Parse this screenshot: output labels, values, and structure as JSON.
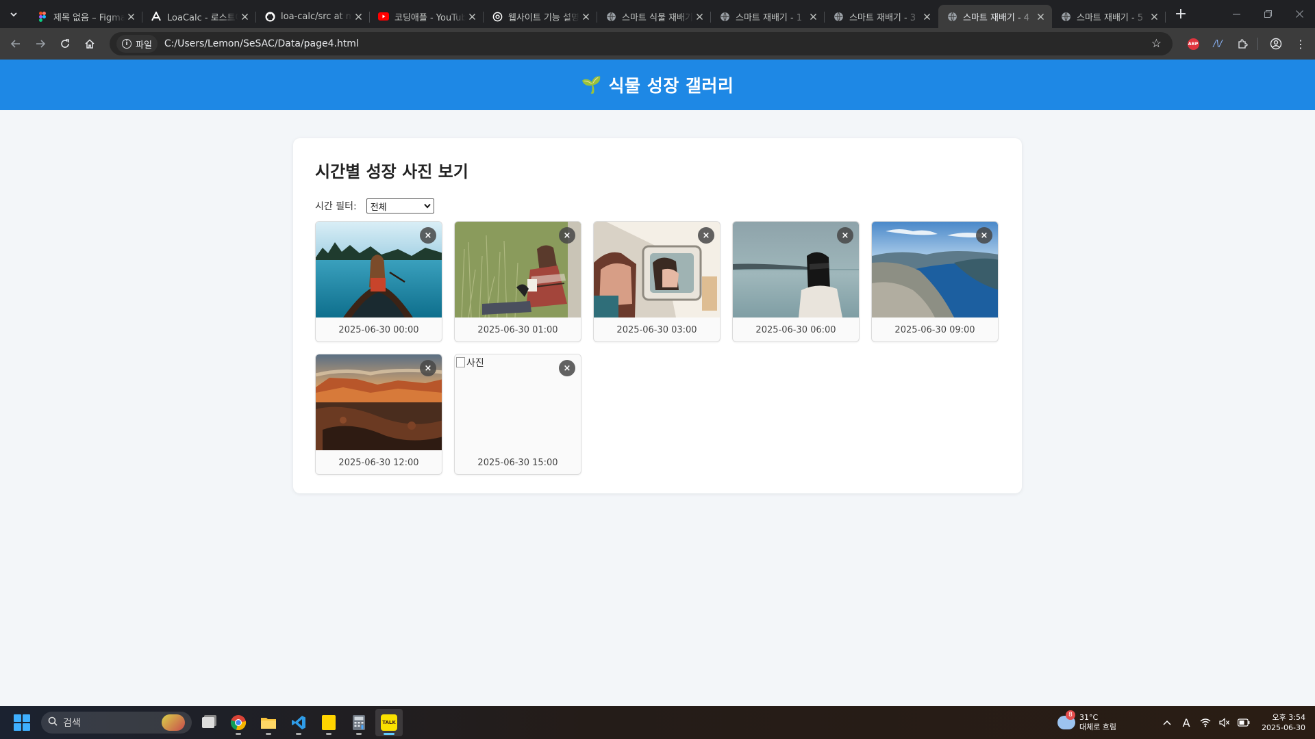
{
  "browser": {
    "tabs": [
      {
        "title": "제목 없음 – Figma",
        "favicon": "figma-icon",
        "active": false
      },
      {
        "title": "LoaCalc - 로스트아크",
        "favicon": "loacalc-icon",
        "active": false
      },
      {
        "title": "loa-calc/src at main",
        "favicon": "github-icon",
        "active": false
      },
      {
        "title": "코딩애플 - YouTube",
        "favicon": "youtube-icon",
        "active": false
      },
      {
        "title": "웹사이트 기능 설명",
        "favicon": "openai-icon",
        "active": false
      },
      {
        "title": "스마트 식물 재배기",
        "favicon": "globe-icon",
        "active": false
      },
      {
        "title": "스마트 재배기 - 1",
        "favicon": "globe-icon",
        "active": false
      },
      {
        "title": "스마트 재배기 - 3",
        "favicon": "globe-icon",
        "active": false
      },
      {
        "title": "스마트 재배기 - 4",
        "favicon": "globe-icon",
        "active": true
      },
      {
        "title": "스마트 재배기 - 5",
        "favicon": "globe-icon",
        "active": false
      }
    ],
    "site_chip": "파일",
    "url": "C:/Users/Lemon/SeSAC/Data/page4.html"
  },
  "page": {
    "header_emoji": "🌱",
    "header_title": "식물 성장 갤러리",
    "panel_title": "시간별 성장 사진 보기",
    "filter_label": "시간 필터:",
    "filter_value": "전체",
    "photos": [
      {
        "caption": "2025-06-30 00:00",
        "scene": "lake-canoe"
      },
      {
        "caption": "2025-06-30 01:00",
        "scene": "grass-reading"
      },
      {
        "caption": "2025-06-30 03:00",
        "scene": "van-window"
      },
      {
        "caption": "2025-06-30 06:00",
        "scene": "sea-blindfold"
      },
      {
        "caption": "2025-06-30 09:00",
        "scene": "fjord-cliff"
      },
      {
        "caption": "2025-06-30 12:00",
        "scene": "canyon-sunset"
      },
      {
        "caption": "2025-06-30 15:00",
        "scene": "broken",
        "alt": "사진"
      }
    ],
    "delete_symbol": "×"
  },
  "taskbar": {
    "search_placeholder": "검색",
    "weather": {
      "badge": "8",
      "temp": "31°C",
      "desc": "대체로 흐림"
    },
    "clock": {
      "time": "오후 3:54",
      "date": "2025-06-30"
    }
  },
  "colors": {
    "header": "#1e88e5",
    "background": "#f3f6f9",
    "tab_active": "#3c3c3c"
  }
}
